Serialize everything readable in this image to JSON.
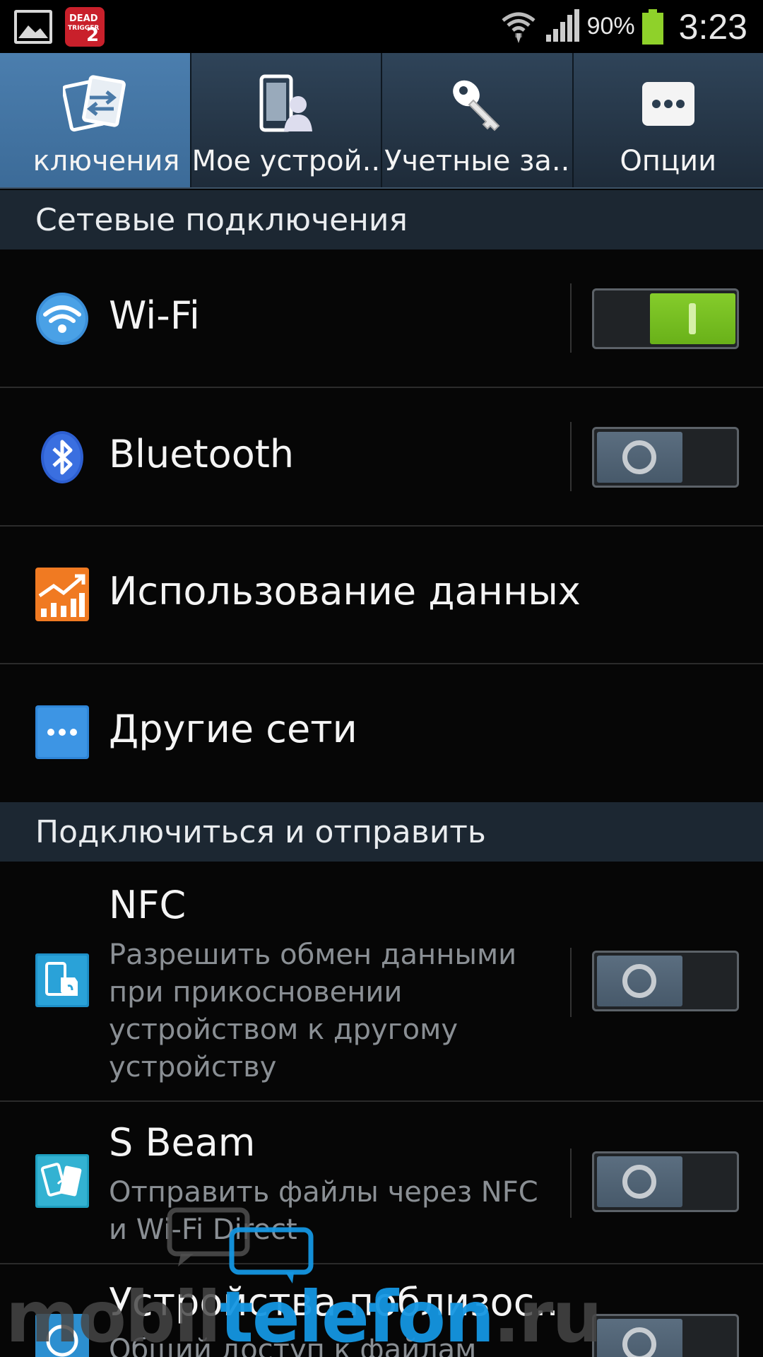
{
  "status_bar": {
    "battery_percent": "90%",
    "time": "3:23",
    "notification_icons": [
      "gallery-icon",
      "dead-trigger-2-app-icon"
    ],
    "app_icon_text_line1": "DEAD",
    "app_icon_text_line2": "TRIGGER",
    "app_icon_text_num": "2"
  },
  "tabs": [
    {
      "label": "ключения",
      "icon": "connections-icon",
      "active": true
    },
    {
      "label": "Мое устрой..",
      "icon": "my-device-icon",
      "active": false
    },
    {
      "label": "Учетные за..",
      "icon": "accounts-key-icon",
      "active": false
    },
    {
      "label": "Опции",
      "icon": "more-options-icon",
      "active": false
    }
  ],
  "sections": {
    "network": "Сетевые подключения",
    "connect_share": "Подключиться и отправить"
  },
  "rows": {
    "wifi": {
      "title": "Wi-Fi",
      "icon": "wifi-icon",
      "toggle_on": true
    },
    "bluetooth": {
      "title": "Bluetooth",
      "icon": "bluetooth-icon",
      "toggle_on": false
    },
    "data_usage": {
      "title": "Использование данных",
      "icon": "data-usage-icon"
    },
    "other_networks": {
      "title": "Другие сети",
      "icon": "more-networks-icon"
    },
    "nfc": {
      "title": "NFC",
      "subtitle": "Разрешить обмен данными при прикосновении устройством к другому устройству",
      "icon": "nfc-icon",
      "toggle_on": false
    },
    "s_beam": {
      "title": "S Beam",
      "subtitle": "Отправить файлы через NFC и Wi-Fi Direct",
      "icon": "s-beam-icon",
      "toggle_on": false
    },
    "nearby": {
      "title": "Устройства поблизос..",
      "subtitle": "Общий доступ к файлам",
      "icon": "nearby-devices-icon",
      "toggle_on": false
    }
  },
  "watermark": {
    "gray": "mobil",
    "blue": "telefon",
    "suffix": ".ru"
  },
  "colors": {
    "accent_tab": "#4577a6",
    "section_bg": "#1c2732",
    "toggle_on": "#7cc225",
    "toggle_off": "#51657a"
  }
}
